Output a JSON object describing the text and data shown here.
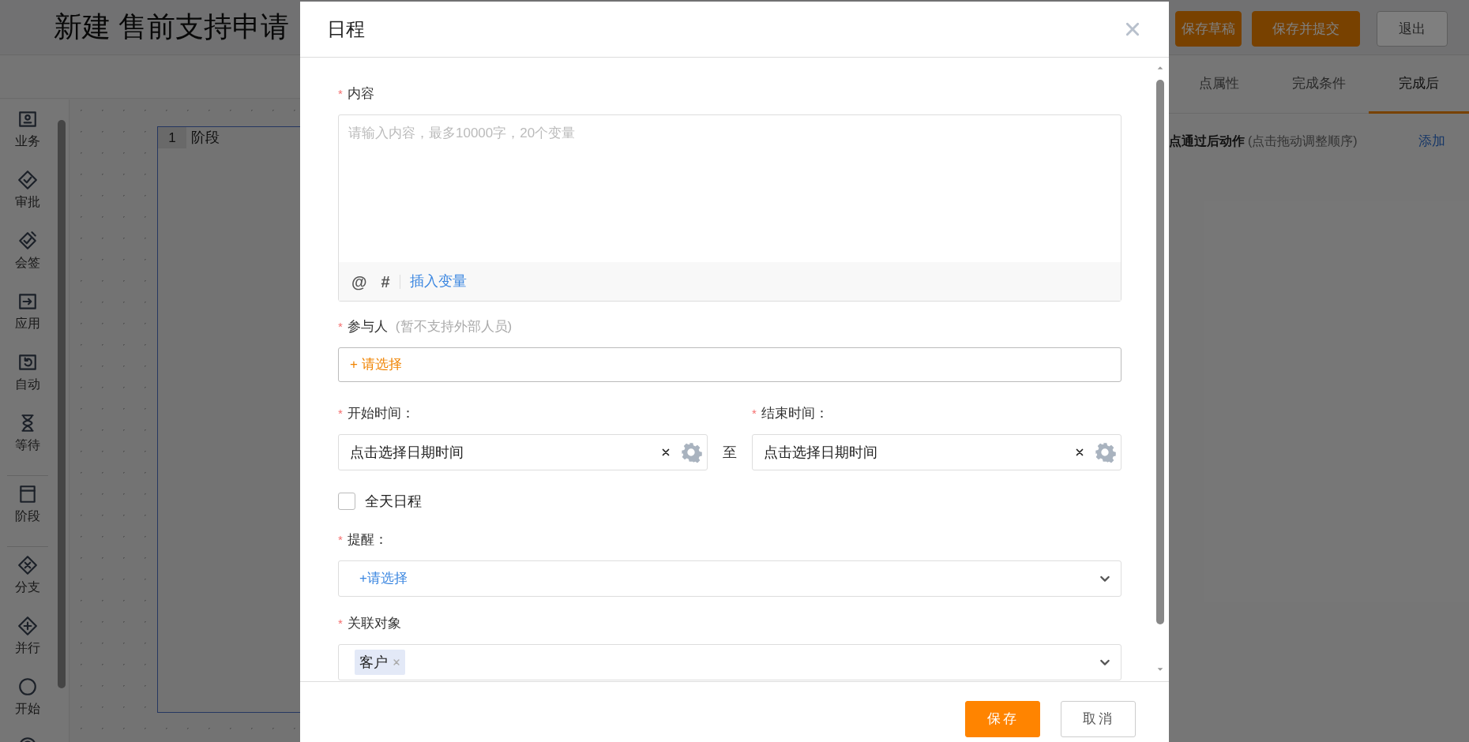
{
  "page": {
    "title": "新建 售前支持申请",
    "buttons": [
      {
        "label": "保存草稿",
        "kind": "primary"
      },
      {
        "label": "保存并提交",
        "kind": "primary"
      },
      {
        "label": "退出",
        "kind": "secondary"
      }
    ]
  },
  "toolbox": [
    [
      {
        "label": "业务"
      },
      {
        "label": "审批"
      },
      {
        "label": "会签"
      },
      {
        "label": "应用"
      },
      {
        "label": "自动"
      },
      {
        "label": "等待"
      }
    ],
    [
      {
        "label": "阶段"
      }
    ],
    [
      {
        "label": "分支"
      },
      {
        "label": "并行"
      },
      {
        "label": "开始"
      }
    ]
  ],
  "canvas": {
    "stage": {
      "number": "1",
      "label": "阶段"
    }
  },
  "panel": {
    "tabs": [
      {
        "label": "点属性",
        "selected": false
      },
      {
        "label": "完成条件",
        "selected": false
      },
      {
        "label": "完成后",
        "selected": true
      }
    ],
    "section_title": "点通过后动作",
    "section_hint": "(点击拖动调整顺序)",
    "add_link": "添加"
  },
  "dialog": {
    "title": "日程",
    "required_mark": "*",
    "content": {
      "label": "内容",
      "required": true,
      "placeholder": "请输入内容，最多10000字，20个变量",
      "tools": [
        "@",
        "#"
      ],
      "insert_link": "插入变量"
    },
    "participants": {
      "label": "参与人",
      "required": true,
      "hint": "(暂不支持外部人员)",
      "picker": "+ 请选择"
    },
    "start": {
      "label": "开始时间：",
      "required": true,
      "value": "点击选择日期时间"
    },
    "range_separator": "至",
    "end": {
      "label": "结束时间：",
      "required": true,
      "value": "点击选择日期时间"
    },
    "all_day": {
      "label": "全天日程",
      "checked": false
    },
    "reminder": {
      "label": "提醒：",
      "required": true,
      "picker": "+请选择"
    },
    "related": {
      "label": "关联对象",
      "required": true,
      "tags": [
        {
          "label": "客户"
        }
      ]
    },
    "buttons": [
      {
        "label": "保存",
        "kind": "primary"
      },
      {
        "label": "取消",
        "kind": "secondary"
      }
    ]
  }
}
